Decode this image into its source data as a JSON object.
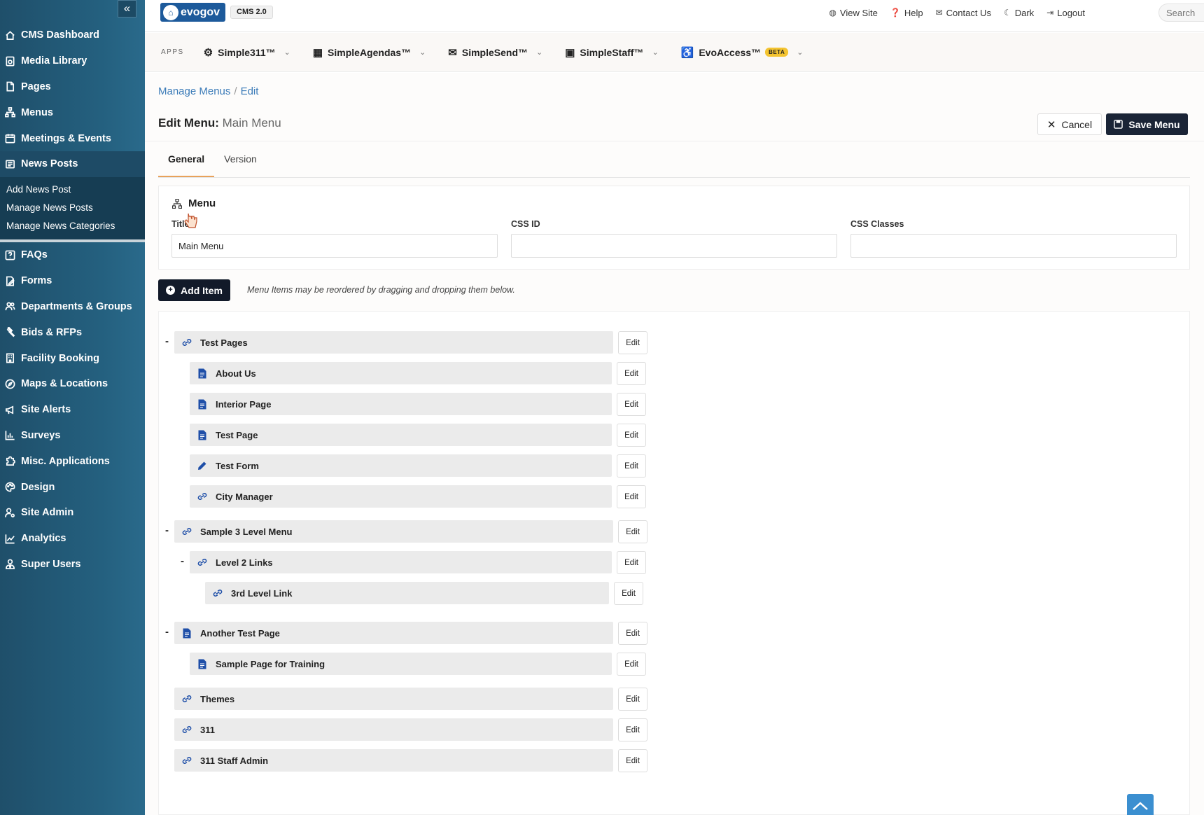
{
  "sidebar": {
    "collapse_label": "«",
    "items_top": [
      {
        "label": "CMS Dashboard",
        "icon": "home-icon"
      },
      {
        "label": "Media Library",
        "icon": "media-icon"
      },
      {
        "label": "Pages",
        "icon": "page-icon"
      },
      {
        "label": "Menus",
        "icon": "sitemap-icon"
      },
      {
        "label": "Meetings & Events",
        "icon": "calendar-icon"
      },
      {
        "label": "News Posts",
        "icon": "newspaper-icon"
      }
    ],
    "subitems": [
      "Add News Post",
      "Manage News Posts",
      "Manage News Categories"
    ],
    "items_bottom": [
      {
        "label": "FAQs",
        "icon": "question-icon"
      },
      {
        "label": "Forms",
        "icon": "form-icon"
      },
      {
        "label": "Departments & Groups",
        "icon": "users-icon"
      },
      {
        "label": "Bids & RFPs",
        "icon": "gavel-icon"
      },
      {
        "label": "Facility Booking",
        "icon": "building-icon"
      },
      {
        "label": "Maps & Locations",
        "icon": "compass-icon"
      },
      {
        "label": "Site Alerts",
        "icon": "megaphone-icon"
      },
      {
        "label": "Surveys",
        "icon": "bar-chart-icon"
      },
      {
        "label": "Misc. Applications",
        "icon": "puzzle-icon"
      },
      {
        "label": "Design",
        "icon": "palette-icon"
      },
      {
        "label": "Site Admin",
        "icon": "user-cog-icon"
      },
      {
        "label": "Analytics",
        "icon": "line-chart-icon"
      },
      {
        "label": "Super Users",
        "icon": "user-tie-icon"
      }
    ]
  },
  "topbar": {
    "logo": "evogov",
    "cms_badge": "CMS 2.0",
    "links": [
      {
        "label": "View Site",
        "icon": "globe-icon"
      },
      {
        "label": "Help",
        "icon": "help-icon"
      },
      {
        "label": "Contact Us",
        "icon": "envelope-icon"
      },
      {
        "label": "Dark",
        "icon": "moon-icon"
      },
      {
        "label": "Logout",
        "icon": "logout-icon"
      }
    ],
    "search_placeholder": "Search"
  },
  "apps": {
    "label": "APPS",
    "items": [
      {
        "label": "Simple311™",
        "icon": "gear-icon"
      },
      {
        "label": "SimpleAgendas™",
        "icon": "calendar-icon"
      },
      {
        "label": "SimpleSend™",
        "icon": "envelope-icon"
      },
      {
        "label": "SimpleStaff™",
        "icon": "briefcase-icon"
      },
      {
        "label": "EvoAccess™",
        "icon": "accessibility-icon",
        "badge": "BETA"
      }
    ]
  },
  "breadcrumb": {
    "parent": "Manage Menus",
    "sep": "/",
    "current": "Edit"
  },
  "header": {
    "title": "Edit Menu:",
    "subtitle": "Main Menu",
    "cancel_label": "Cancel",
    "save_label": "Save Menu"
  },
  "tabs": [
    "General",
    "Version"
  ],
  "menu_card": {
    "heading": "Menu",
    "fields": [
      {
        "label": "Title",
        "value": "Main Menu"
      },
      {
        "label": "CSS ID",
        "value": ""
      },
      {
        "label": "CSS Classes",
        "value": ""
      }
    ]
  },
  "add_item_label": "Add Item",
  "hint": "Menu Items may be reordered by dragging and dropping them below.",
  "edit_label": "Edit",
  "collapse_marker": "-",
  "tree": [
    {
      "label": "Test Pages",
      "level": 0,
      "icon": "link-icon",
      "collapsible": true
    },
    {
      "label": "About Us",
      "level": 1,
      "icon": "page-icon"
    },
    {
      "label": "Interior Page",
      "level": 1,
      "icon": "page-icon"
    },
    {
      "label": "Test Page",
      "level": 1,
      "icon": "page-icon"
    },
    {
      "label": "Test Form",
      "level": 1,
      "icon": "pencil-icon"
    },
    {
      "label": "City Manager",
      "level": 1,
      "icon": "link-icon"
    },
    {
      "label": "Sample 3 Level Menu",
      "level": 0,
      "icon": "link-icon",
      "collapsible": true
    },
    {
      "label": "Level 2 Links",
      "level": 1,
      "icon": "link-icon",
      "collapsible": true
    },
    {
      "label": "3rd Level Link",
      "level": 2,
      "icon": "link-icon"
    },
    {
      "label": "Another Test Page",
      "level": 0,
      "icon": "page-icon",
      "collapsible": true
    },
    {
      "label": "Sample Page for Training",
      "level": 1,
      "icon": "page-icon"
    },
    {
      "label": "Themes",
      "level": 0,
      "icon": "link-icon"
    },
    {
      "label": "311",
      "level": 0,
      "icon": "link-icon"
    },
    {
      "label": "311 Staff Admin",
      "level": 0,
      "icon": "link-icon"
    }
  ],
  "colors": {
    "sidebar": "#24607f",
    "primary_button": "#1a2436",
    "link": "#3b7bb8",
    "tab_accent": "#e8a25b",
    "icon_blue": "#1f4fa8"
  }
}
